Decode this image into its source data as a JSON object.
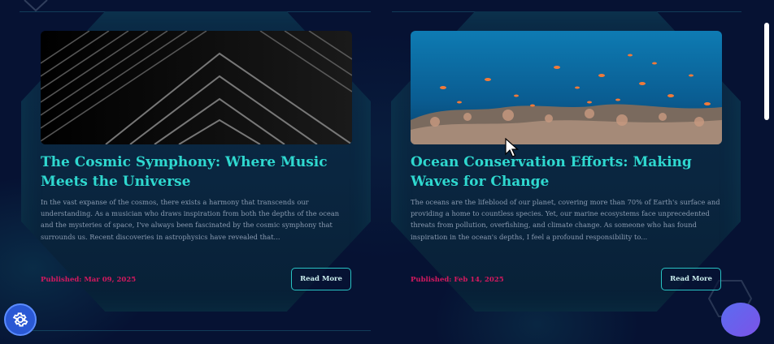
{
  "posts": [
    {
      "title": "The Cosmic Symphony: Where Music Meets the Universe",
      "excerpt": "In the vast expanse of the cosmos, there exists a harmony that transcends our understanding. As a musician who draws inspiration from both the depths of the ocean and the mysteries of space, I've always been fascinated by the cosmic symphony that surrounds us. Recent discoveries in astrophysics have revealed that...",
      "date": "Published: Mar 09, 2025",
      "button": "Read More",
      "image": "abstract dark architecture"
    },
    {
      "title": "Ocean Conservation Efforts: Making Waves for Change",
      "excerpt": "The oceans are the lifeblood of our planet, covering more than 70% of Earth's surface and providing a home to countless species. Yet, our marine ecosystems face unprecedented threats from pollution, overfishing, and climate change. As someone who has found inspiration in the ocean's depths, I feel a profound responsibility to...",
      "date": "Published: Feb 14, 2025",
      "button": "Read More",
      "image": "coral reef with fish"
    }
  ],
  "icons": {
    "settings": "gear-icon",
    "chat": "chat-bubble-icon",
    "cursor": "mouse-pointer-icon"
  },
  "colors": {
    "title": "#2fd8cf",
    "date": "#d4195f",
    "button_border": "#28c2c3",
    "background": "#061233"
  }
}
